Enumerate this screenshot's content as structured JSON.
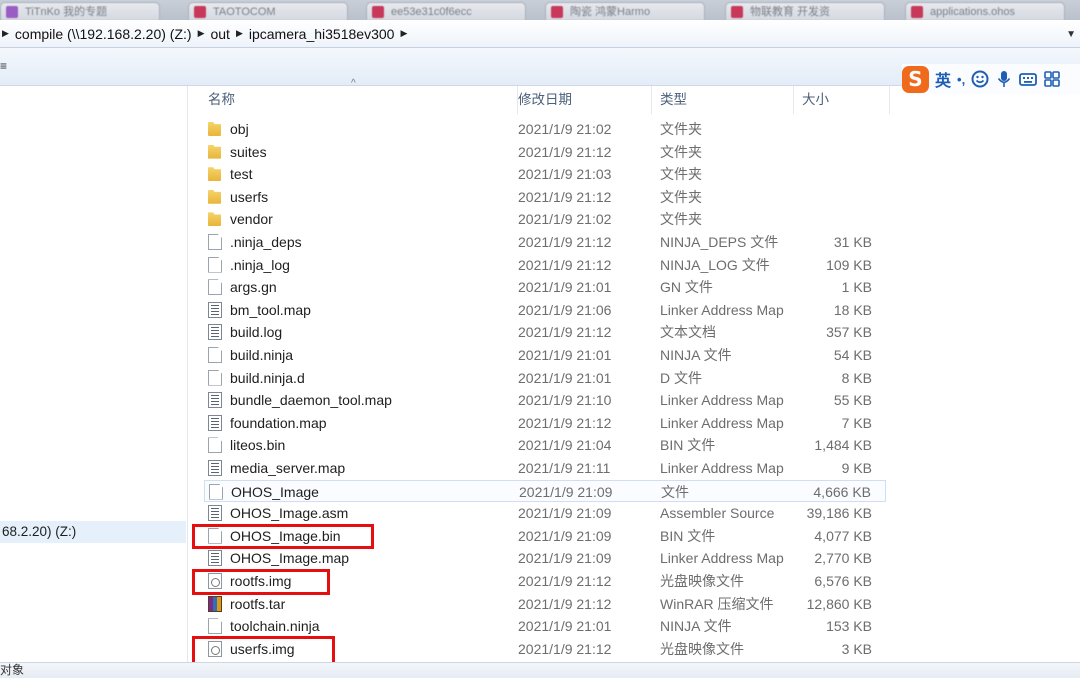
{
  "browser_tabs": [
    {
      "label": "TiTnKo 我的专题"
    },
    {
      "label": "TAOTOCOM"
    },
    {
      "label": "ee53e31c0f6ecc"
    },
    {
      "label": "陶瓷 鸿蒙Harmo"
    },
    {
      "label": "物联教育 开发资"
    },
    {
      "label": "applications.ohos"
    }
  ],
  "address": {
    "crumbs": [
      "compile (\\\\192.168.2.20) (Z:)",
      "out",
      "ipcamera_hi3518ev300"
    ]
  },
  "ime": {
    "logo": "S",
    "lang": "英",
    "punct": "•,"
  },
  "navpane": {
    "drive_label": "68.2.20) (Z:)"
  },
  "columns": {
    "name": "名称",
    "date": "修改日期",
    "type": "类型",
    "size": "大小"
  },
  "files": [
    {
      "name": "obj",
      "date": "2021/1/9 21:02",
      "type": "文件夹",
      "size": "",
      "icon": "folder-icon"
    },
    {
      "name": "suites",
      "date": "2021/1/9 21:12",
      "type": "文件夹",
      "size": "",
      "icon": "folder-icon"
    },
    {
      "name": "test",
      "date": "2021/1/9 21:03",
      "type": "文件夹",
      "size": "",
      "icon": "folder-icon"
    },
    {
      "name": "userfs",
      "date": "2021/1/9 21:12",
      "type": "文件夹",
      "size": "",
      "icon": "folder-icon"
    },
    {
      "name": "vendor",
      "date": "2021/1/9 21:02",
      "type": "文件夹",
      "size": "",
      "icon": "folder-icon"
    },
    {
      "name": ".ninja_deps",
      "date": "2021/1/9 21:12",
      "type": "NINJA_DEPS 文件",
      "size": "31 KB",
      "icon": "file-icon"
    },
    {
      "name": ".ninja_log",
      "date": "2021/1/9 21:12",
      "type": "NINJA_LOG 文件",
      "size": "109 KB",
      "icon": "file-icon"
    },
    {
      "name": "args.gn",
      "date": "2021/1/9 21:01",
      "type": "GN 文件",
      "size": "1 KB",
      "icon": "file-icon"
    },
    {
      "name": "bm_tool.map",
      "date": "2021/1/9 21:06",
      "type": "Linker Address Map",
      "size": "18 KB",
      "icon": "text-file-icon"
    },
    {
      "name": "build.log",
      "date": "2021/1/9 21:12",
      "type": "文本文档",
      "size": "357 KB",
      "icon": "text-file-icon"
    },
    {
      "name": "build.ninja",
      "date": "2021/1/9 21:01",
      "type": "NINJA 文件",
      "size": "54 KB",
      "icon": "file-icon"
    },
    {
      "name": "build.ninja.d",
      "date": "2021/1/9 21:01",
      "type": "D 文件",
      "size": "8 KB",
      "icon": "file-icon"
    },
    {
      "name": "bundle_daemon_tool.map",
      "date": "2021/1/9 21:10",
      "type": "Linker Address Map",
      "size": "55 KB",
      "icon": "text-file-icon"
    },
    {
      "name": "foundation.map",
      "date": "2021/1/9 21:12",
      "type": "Linker Address Map",
      "size": "7 KB",
      "icon": "text-file-icon"
    },
    {
      "name": "liteos.bin",
      "date": "2021/1/9 21:04",
      "type": "BIN 文件",
      "size": "1,484 KB",
      "icon": "file-icon"
    },
    {
      "name": "media_server.map",
      "date": "2021/1/9 21:11",
      "type": "Linker Address Map",
      "size": "9 KB",
      "icon": "text-file-icon"
    },
    {
      "name": "OHOS_Image",
      "date": "2021/1/9 21:09",
      "type": "文件",
      "size": "4,666 KB",
      "icon": "file-icon",
      "selected": true
    },
    {
      "name": "OHOS_Image.asm",
      "date": "2021/1/9 21:09",
      "type": "Assembler Source",
      "size": "39,186 KB",
      "icon": "text-file-icon"
    },
    {
      "name": "OHOS_Image.bin",
      "date": "2021/1/9 21:09",
      "type": "BIN 文件",
      "size": "4,077 KB",
      "icon": "file-icon"
    },
    {
      "name": "OHOS_Image.map",
      "date": "2021/1/9 21:09",
      "type": "Linker Address Map",
      "size": "2,770 KB",
      "icon": "text-file-icon"
    },
    {
      "name": "rootfs.img",
      "date": "2021/1/9 21:12",
      "type": "光盘映像文件",
      "size": "6,576 KB",
      "icon": "disc-image-icon"
    },
    {
      "name": "rootfs.tar",
      "date": "2021/1/9 21:12",
      "type": "WinRAR 压缩文件",
      "size": "12,860 KB",
      "icon": "winrar-icon"
    },
    {
      "name": "toolchain.ninja",
      "date": "2021/1/9 21:01",
      "type": "NINJA 文件",
      "size": "153 KB",
      "icon": "file-icon"
    },
    {
      "name": "userfs.img",
      "date": "2021/1/9 21:12",
      "type": "光盘映像文件",
      "size": "3 KB",
      "icon": "disc-image-icon"
    }
  ],
  "highlighted_files": [
    "OHOS_Image.bin",
    "rootfs.img",
    "userfs.img"
  ],
  "status": {
    "text": "对象"
  },
  "colors": {
    "highlight": "#e60f0f",
    "ime_brand": "#ef6a1b",
    "ime_icons": "#1e5fb4"
  }
}
